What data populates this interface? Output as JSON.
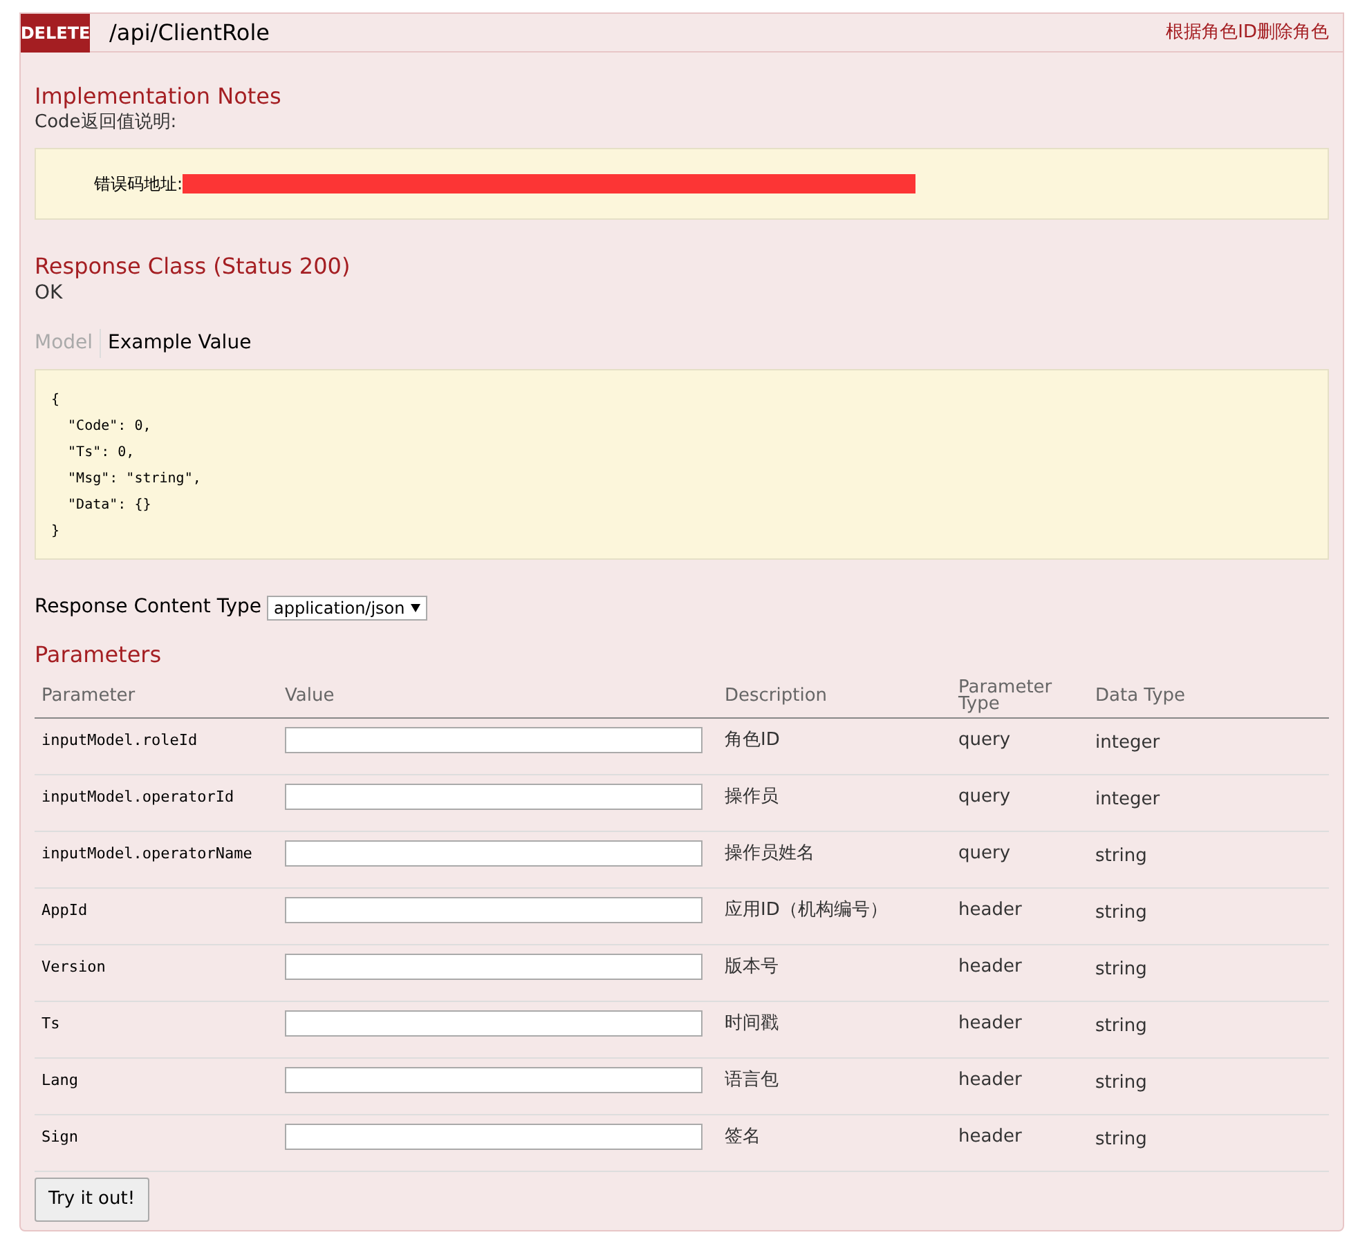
{
  "operation": {
    "method": "DELETE",
    "path": "/api/ClientRole",
    "summary": "根据角色ID删除角色"
  },
  "implementation_notes": {
    "title": "Implementation Notes",
    "text": "Code返回值说明:",
    "note_label": "错误码地址:"
  },
  "response_class": {
    "title": "Response Class (Status 200)",
    "text": "OK"
  },
  "model_tabs": [
    {
      "label": "Model",
      "selected": false
    },
    {
      "label": "Example Value",
      "selected": true
    }
  ],
  "example_value": [
    "{",
    "  \"Code\": 0,",
    "  \"Ts\": 0,",
    "  \"Msg\": \"string\",",
    "  \"Data\": {}",
    "}"
  ],
  "response_content_type": {
    "label": "Response Content Type",
    "value": "application/json"
  },
  "parameters": {
    "title": "Parameters",
    "columns": [
      "Parameter",
      "Value",
      "Description",
      "Parameter Type",
      "Data Type"
    ],
    "rows": [
      {
        "name": "inputModel.roleId",
        "description": "角色ID",
        "type": "query",
        "data_type": "integer"
      },
      {
        "name": "inputModel.operatorId",
        "description": "操作员",
        "type": "query",
        "data_type": "integer"
      },
      {
        "name": "inputModel.operatorName",
        "description": "操作员姓名",
        "type": "query",
        "data_type": "string"
      },
      {
        "name": "AppId",
        "description": "应用ID（机构编号）",
        "type": "header",
        "data_type": "string"
      },
      {
        "name": "Version",
        "description": "版本号",
        "type": "header",
        "data_type": "string"
      },
      {
        "name": "Ts",
        "description": "时间戳",
        "type": "header",
        "data_type": "string"
      },
      {
        "name": "Lang",
        "description": "语言包",
        "type": "header",
        "data_type": "string"
      },
      {
        "name": "Sign",
        "description": "签名",
        "type": "header",
        "data_type": "string"
      }
    ]
  },
  "try_button": "Try it out!"
}
